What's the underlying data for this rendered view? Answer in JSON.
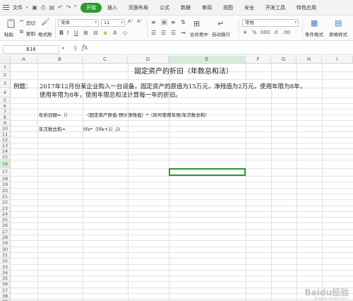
{
  "menubar": {
    "file_label": "文件",
    "tabs": [
      "开始",
      "插入",
      "页面布局",
      "公式",
      "数据",
      "审阅",
      "视图",
      "安全",
      "开发工具",
      "特色应用"
    ],
    "active_tab": "开始"
  },
  "ribbon": {
    "cut_label": "剪切",
    "copy_label": "复制",
    "paste_label": "粘贴",
    "format_painter_label": "格式刷",
    "font_name": "宋体",
    "font_size": "11",
    "merge_center_label": "合并居中",
    "wrap_text_label": "自动换行",
    "number_format": "常规",
    "conditional_format_label": "条件格式",
    "table_style_label": "表格样式"
  },
  "formula_bar": {
    "name_box": "B16",
    "fx_label": "fx",
    "formula": ""
  },
  "sheet": {
    "columns": [
      "A",
      "B",
      "C",
      "D",
      "E",
      "F",
      "G",
      "H",
      "I"
    ],
    "rows": [
      "1",
      "2",
      "3",
      "4",
      "5",
      "6",
      "7",
      "8",
      "9",
      "10",
      "11",
      "12",
      "13",
      "14",
      "15",
      "16",
      "17",
      "18",
      "19",
      "20",
      "21",
      "22",
      "23",
      "24",
      "25",
      "26",
      "27",
      "28",
      "29",
      "30",
      "31",
      "32",
      "33",
      "34",
      "35",
      "36",
      "37",
      "38",
      "39"
    ],
    "active_row": "16",
    "active_col": "E",
    "cells": {
      "title": "固定资产的折旧（年数总和法）",
      "example_label": "例题：",
      "example_line1": "2017年12月份某企业购入一台设备，固定资产的原值为15万元，净残值为2万元，使用年限为8年，",
      "example_line2": "使用年限为8年，使用年限总和法计算每一年的折旧。",
      "r7_label": "年折旧额=（）",
      "r7_formula": "（固定资产原值-预计净残值）*（尚可使用年限/年次数总和）",
      "r9_label": "年次数总和=",
      "r9_formula": "life*（life+1）/2"
    }
  },
  "watermark": {
    "text": "Baidu经验",
    "sub": "jingyan.baidu.com"
  }
}
